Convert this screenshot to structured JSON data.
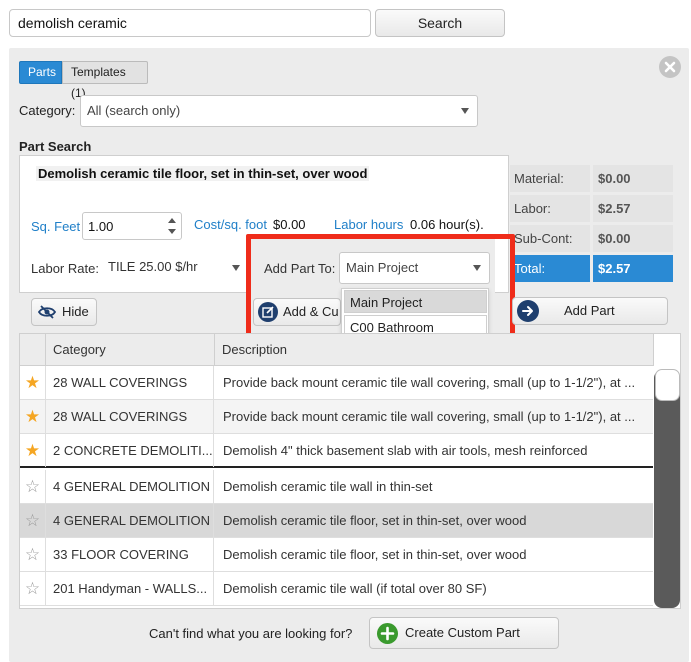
{
  "search": {
    "value": "demolish ceramic",
    "button_label": "Search"
  },
  "tabs": [
    {
      "label": "Parts",
      "active": true
    },
    {
      "label": "Templates (1)",
      "active": false
    }
  ],
  "category": {
    "label": "Category:",
    "selected": "All (search only)"
  },
  "part_search": {
    "title": "Part Search",
    "part_name": "Demolish ceramic tile floor, set in thin-set, over wood",
    "quantity_label": "Sq. Feet",
    "quantity_value": "1.00",
    "cost_label": "Cost/sq. foot",
    "cost_value": "$0.00",
    "labor_hours_label": "Labor hours",
    "labor_hours_value": "0.06 hour(s).",
    "labor_rate_label": "Labor Rate:",
    "labor_rate_value": "TILE 25.00 $/hr"
  },
  "summary": [
    {
      "label": "Material:",
      "value": "$0.00"
    },
    {
      "label": "Labor:",
      "value": "$2.57"
    },
    {
      "label": "Sub-Cont:",
      "value": "$0.00"
    },
    {
      "label": "Total:",
      "value": "$2.57"
    }
  ],
  "add_part_to": {
    "label": "Add Part To:",
    "selected": "Main Project",
    "options": [
      "Main Project",
      "C00 Bathroom"
    ]
  },
  "buttons": {
    "hide": "Hide",
    "add_custom": "Add & Cu",
    "add_part": "Add Part",
    "create_custom": "Create Custom Part"
  },
  "results": {
    "headers": [
      "Category",
      "Description"
    ],
    "rows": [
      {
        "starred": true,
        "category": "28 WALL COVERINGS",
        "description": "Provide back mount ceramic tile wall covering, small (up to 1-1/2\"), at ..."
      },
      {
        "starred": true,
        "category": "28 WALL COVERINGS",
        "description": "Provide back mount ceramic tile wall covering, small (up to 1-1/2\"), at ..."
      },
      {
        "starred": true,
        "category": "2 CONCRETE DEMOLITI...",
        "description": "Demolish 4\" thick basement slab with air tools, mesh reinforced"
      },
      {
        "starred": false,
        "category": "4 GENERAL DEMOLITION",
        "description": "Demolish ceramic tile wall in thin-set"
      },
      {
        "starred": false,
        "category": "4 GENERAL DEMOLITION",
        "description": "Demolish ceramic tile floor, set in thin-set, over wood"
      },
      {
        "starred": false,
        "category": "33 FLOOR COVERING",
        "description": "Demolish ceramic tile floor, set in thin-set, over wood"
      },
      {
        "starred": false,
        "category": "201 Handyman - WALLS...",
        "description": "Demolish ceramic tile wall (if total over 80 SF)"
      }
    ]
  },
  "footer": {
    "prompt": "Can't find what you are looking for?"
  },
  "colors": {
    "accent": "#2a8ad4",
    "highlight": "#ef2c1a",
    "star": "#f5a623",
    "plus": "#3a9a2e"
  },
  "icons": {
    "close": "close-icon",
    "eye": "eye-slash-icon",
    "edit": "edit-icon",
    "arrow": "arrow-right-icon",
    "plus": "plus-icon"
  }
}
